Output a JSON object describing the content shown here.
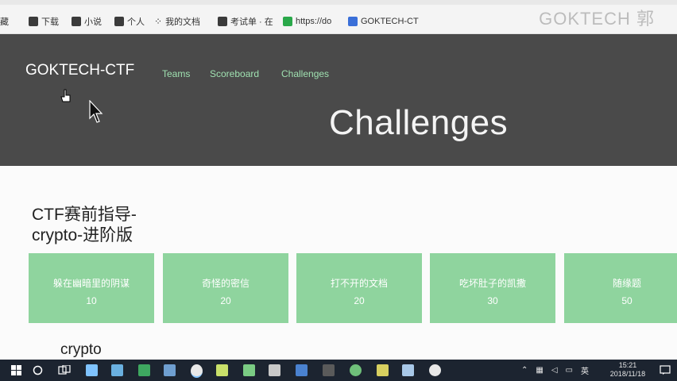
{
  "bookmarks": [
    {
      "label": "藏",
      "icon": "folder-icon"
    },
    {
      "label": "下载",
      "icon": "folder-icon"
    },
    {
      "label": "小说",
      "icon": "folder-icon"
    },
    {
      "label": "个人",
      "icon": "folder-icon"
    },
    {
      "label": "我的文档",
      "icon": "dots-icon"
    },
    {
      "label": "考试单 · 在",
      "icon": "doc-icon"
    },
    {
      "label": "https://do",
      "icon": "link-icon"
    },
    {
      "label": "GOKTECH-CT",
      "icon": "page-icon"
    }
  ],
  "watermark": "GOKTECH 郭",
  "site": {
    "brand": "GOKTECH-CTF",
    "nav": [
      "Teams",
      "Scoreboard",
      "Challenges"
    ],
    "title": "Challenges"
  },
  "categories": [
    {
      "name_lines": [
        "CTF赛前指导-",
        "crypto-进阶版"
      ],
      "challenges": [
        {
          "name": "躲在幽暗里的阴谋",
          "points": "10"
        },
        {
          "name": "奇怪的密信",
          "points": "20"
        },
        {
          "name": "打不开的文档",
          "points": "20"
        },
        {
          "name": "吃坏肚子的凯撒",
          "points": "30"
        },
        {
          "name": "随缘题",
          "points": "50"
        }
      ]
    },
    {
      "name": "crypto"
    }
  ],
  "taskbar": {
    "tray_lang": "英",
    "clock_time": "15:21",
    "clock_date": "2018/11/18"
  },
  "colors": {
    "hero_bg": "#4a4a4a",
    "card_bg": "#8fd49e",
    "nav_text": "#9fe0b0",
    "taskbar_bg": "#1c2430"
  }
}
